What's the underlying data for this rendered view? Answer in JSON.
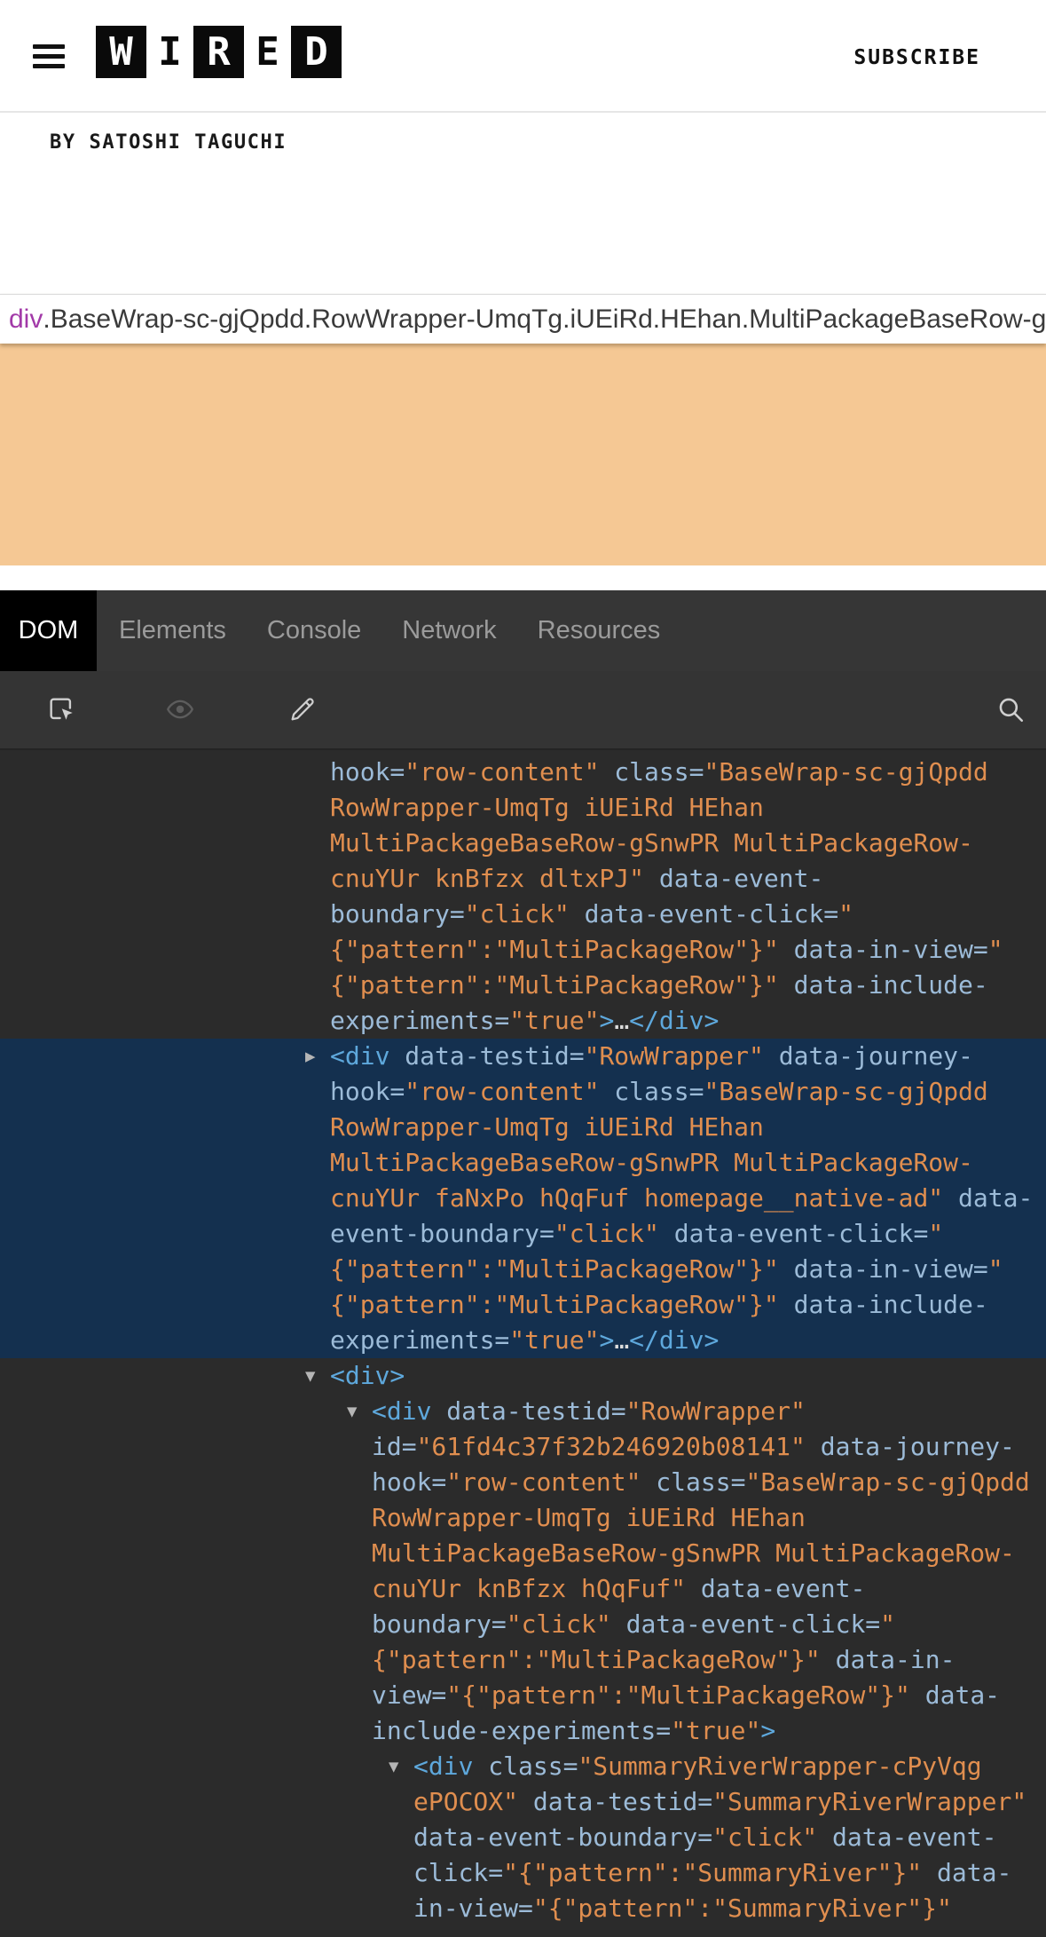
{
  "header": {
    "logo_letters": [
      "W",
      "I",
      "R",
      "E",
      "D"
    ],
    "subscribe_label": "SUBSCRIBE",
    "byline": "BY SATOSHI TAGUCHI"
  },
  "selector_bar": {
    "tag": "div",
    "classes": ".BaseWrap-sc-gjQpdd.RowWrapper-UmqTg.iUEiRd.HEhan.MultiPackageBaseRow-gSnwP"
  },
  "highlight": {
    "color": "#f5c894"
  },
  "devtools": {
    "tabs": [
      {
        "label": "DOM",
        "active": true
      },
      {
        "label": "Elements",
        "active": false
      },
      {
        "label": "Console",
        "active": false
      },
      {
        "label": "Network",
        "active": false
      },
      {
        "label": "Resources",
        "active": false
      }
    ],
    "toolbar_icons": [
      "element-picker-icon",
      "eye-icon",
      "edit-icon",
      "search-icon"
    ],
    "syntax_colors": {
      "tag": "#5ea8dc",
      "attribute": "#9cbbd8",
      "value": "#e08e4f",
      "ellipsis": "#dcdcdc",
      "selected_row_bg": "#14304f",
      "tree_bg": "#2b2b2b"
    },
    "tree": {
      "blocks": [
        {
          "indent": 0,
          "selected": false,
          "triangle": null,
          "lines": [
            [
              {
                "c": "a",
                "t": "hook="
              },
              {
                "c": "v",
                "t": "\"row-content\""
              },
              {
                "c": "a",
                "t": " class="
              },
              {
                "c": "v",
                "t": "\"BaseWrap-sc-gjQpdd"
              }
            ],
            [
              {
                "c": "v",
                "t": "RowWrapper-UmqTg iUEiRd HEhan"
              }
            ],
            [
              {
                "c": "v",
                "t": "MultiPackageBaseRow-gSnwPR MultiPackageRow-"
              }
            ],
            [
              {
                "c": "v",
                "t": "cnuYUr knBfzx dltxPJ\""
              },
              {
                "c": "a",
                "t": " data-event-"
              }
            ],
            [
              {
                "c": "a",
                "t": "boundary="
              },
              {
                "c": "v",
                "t": "\"click\""
              },
              {
                "c": "a",
                "t": " data-event-click="
              },
              {
                "c": "v",
                "t": "\""
              }
            ],
            [
              {
                "c": "v",
                "t": "{\"pattern\":\"MultiPackageRow\"}\""
              },
              {
                "c": "a",
                "t": " data-in-view="
              },
              {
                "c": "v",
                "t": "\""
              }
            ],
            [
              {
                "c": "v",
                "t": "{\"pattern\":\"MultiPackageRow\"}\""
              },
              {
                "c": "a",
                "t": " data-include-"
              }
            ],
            [
              {
                "c": "a",
                "t": "experiments="
              },
              {
                "c": "v",
                "t": "\"true\""
              },
              {
                "c": "t",
                "t": ">"
              },
              {
                "c": "p",
                "t": "…"
              },
              {
                "c": "t",
                "t": "</div>"
              }
            ]
          ]
        },
        {
          "indent": 0,
          "selected": true,
          "triangle": "▶",
          "lines": [
            [
              {
                "c": "t",
                "t": "<div "
              },
              {
                "c": "a",
                "t": "data-testid="
              },
              {
                "c": "v",
                "t": "\"RowWrapper\""
              },
              {
                "c": "a",
                "t": " data-journey-"
              }
            ],
            [
              {
                "c": "a",
                "t": "hook="
              },
              {
                "c": "v",
                "t": "\"row-content\""
              },
              {
                "c": "a",
                "t": " class="
              },
              {
                "c": "v",
                "t": "\"BaseWrap-sc-gjQpdd"
              }
            ],
            [
              {
                "c": "v",
                "t": "RowWrapper-UmqTg iUEiRd HEhan"
              }
            ],
            [
              {
                "c": "v",
                "t": "MultiPackageBaseRow-gSnwPR MultiPackageRow-"
              }
            ],
            [
              {
                "c": "v",
                "t": "cnuYUr faNxPo hQqFuf homepage__native-ad\""
              },
              {
                "c": "a",
                "t": " data-"
              }
            ],
            [
              {
                "c": "a",
                "t": "event-boundary="
              },
              {
                "c": "v",
                "t": "\"click\""
              },
              {
                "c": "a",
                "t": " data-event-click="
              },
              {
                "c": "v",
                "t": "\""
              }
            ],
            [
              {
                "c": "v",
                "t": "{\"pattern\":\"MultiPackageRow\"}\""
              },
              {
                "c": "a",
                "t": " data-in-view="
              },
              {
                "c": "v",
                "t": "\""
              }
            ],
            [
              {
                "c": "v",
                "t": "{\"pattern\":\"MultiPackageRow\"}\""
              },
              {
                "c": "a",
                "t": " data-include-"
              }
            ],
            [
              {
                "c": "a",
                "t": "experiments="
              },
              {
                "c": "v",
                "t": "\"true\""
              },
              {
                "c": "t",
                "t": ">"
              },
              {
                "c": "p",
                "t": "…"
              },
              {
                "c": "t",
                "t": "</div>"
              }
            ]
          ]
        },
        {
          "indent": 0,
          "selected": false,
          "triangle": "▼",
          "lines": [
            [
              {
                "c": "t",
                "t": "<div>"
              }
            ]
          ]
        },
        {
          "indent": 1,
          "selected": false,
          "triangle": "▼",
          "lines": [
            [
              {
                "c": "t",
                "t": "<div "
              },
              {
                "c": "a",
                "t": "data-testid="
              },
              {
                "c": "v",
                "t": "\"RowWrapper\""
              }
            ],
            [
              {
                "c": "a",
                "t": "id="
              },
              {
                "c": "v",
                "t": "\"61fd4c37f32b246920b08141\""
              },
              {
                "c": "a",
                "t": " data-journey-"
              }
            ],
            [
              {
                "c": "a",
                "t": "hook="
              },
              {
                "c": "v",
                "t": "\"row-content\""
              },
              {
                "c": "a",
                "t": " class="
              },
              {
                "c": "v",
                "t": "\"BaseWrap-sc-gjQpdd"
              }
            ],
            [
              {
                "c": "v",
                "t": "RowWrapper-UmqTg iUEiRd HEhan"
              }
            ],
            [
              {
                "c": "v",
                "t": "MultiPackageBaseRow-gSnwPR MultiPackageRow-"
              }
            ],
            [
              {
                "c": "v",
                "t": "cnuYUr knBfzx hQqFuf\""
              },
              {
                "c": "a",
                "t": " data-event-"
              }
            ],
            [
              {
                "c": "a",
                "t": "boundary="
              },
              {
                "c": "v",
                "t": "\"click\""
              },
              {
                "c": "a",
                "t": " data-event-click="
              },
              {
                "c": "v",
                "t": "\""
              }
            ],
            [
              {
                "c": "v",
                "t": "{\"pattern\":\"MultiPackageRow\"}\""
              },
              {
                "c": "a",
                "t": " data-in-"
              }
            ],
            [
              {
                "c": "a",
                "t": "view="
              },
              {
                "c": "v",
                "t": "\"{\"pattern\":\"MultiPackageRow\"}\""
              },
              {
                "c": "a",
                "t": " data-"
              }
            ],
            [
              {
                "c": "a",
                "t": "include-experiments="
              },
              {
                "c": "v",
                "t": "\"true\""
              },
              {
                "c": "t",
                "t": ">"
              }
            ]
          ]
        },
        {
          "indent": 2,
          "selected": false,
          "triangle": "▼",
          "lines": [
            [
              {
                "c": "t",
                "t": "<div "
              },
              {
                "c": "a",
                "t": "class="
              },
              {
                "c": "v",
                "t": "\"SummaryRiverWrapper-cPyVqg"
              }
            ],
            [
              {
                "c": "v",
                "t": "ePOCOX\""
              },
              {
                "c": "a",
                "t": " data-testid="
              },
              {
                "c": "v",
                "t": "\"SummaryRiverWrapper\""
              }
            ],
            [
              {
                "c": "a",
                "t": "data-event-boundary="
              },
              {
                "c": "v",
                "t": "\"click\""
              },
              {
                "c": "a",
                "t": " data-event-"
              }
            ],
            [
              {
                "c": "a",
                "t": "click="
              },
              {
                "c": "v",
                "t": "\"{\"pattern\":\"SummaryRiver\"}\""
              },
              {
                "c": "a",
                "t": " data-"
              }
            ],
            [
              {
                "c": "a",
                "t": "in-view="
              },
              {
                "c": "v",
                "t": "\"{\"pattern\":\"SummaryRiver\"}\""
              }
            ]
          ]
        }
      ]
    }
  }
}
